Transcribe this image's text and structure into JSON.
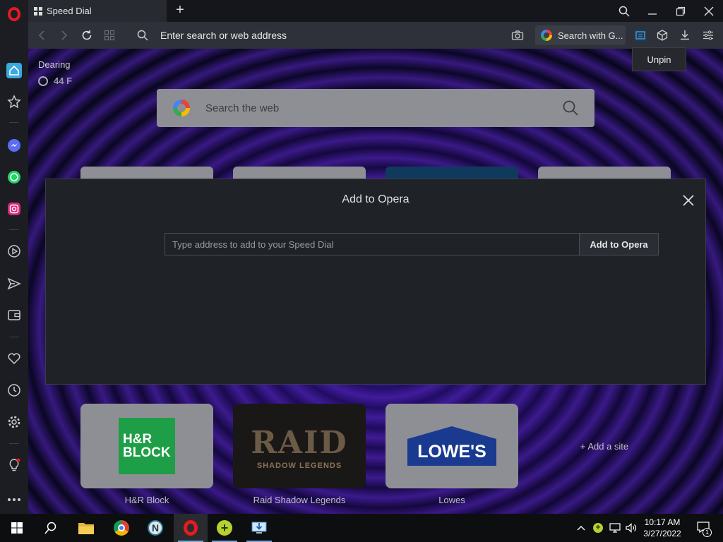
{
  "tab": {
    "title": "Speed Dial"
  },
  "address_bar": {
    "placeholder": "Enter search or web address",
    "search_engine_label": "Search with G..."
  },
  "tooltip": {
    "text": "Unpin"
  },
  "weather": {
    "location": "Dearing",
    "temperature": "44 F"
  },
  "search_box": {
    "placeholder": "Search the web"
  },
  "modal": {
    "title": "Add to Opera",
    "input_placeholder": "Type address to add to your Speed Dial",
    "button_label": "Add to Opera"
  },
  "speed_dial": {
    "tiles": [
      {
        "label": "H&R Block",
        "logo_text_1": "H&R",
        "logo_text_2": "BLOCK",
        "brand_color": "#1e9e47"
      },
      {
        "label": "Raid Shadow Legends",
        "logo_text_1": "RAID",
        "logo_text_2": "SHADOW LEGENDS"
      },
      {
        "label": "Lowes",
        "logo_text_1": "LOWE'S",
        "brand_color": "#1a3a8f"
      }
    ],
    "add_site_label": "+ Add a site"
  },
  "sidebar": {
    "items": [
      "home-icon",
      "bookmarks-icon",
      "messenger-icon",
      "whatsapp-icon",
      "instagram-icon",
      "player-icon",
      "send-icon",
      "wallet-icon",
      "heart-icon",
      "history-icon",
      "settings-icon",
      "tips-icon",
      "more-icon"
    ]
  },
  "taskbar": {
    "time": "10:17 AM",
    "date": "3/27/2022",
    "notification_count": "1"
  },
  "colors": {
    "opera_red": "#e31b23",
    "sidebar_bg": "#1b1d23",
    "address_bar_bg": "#2e3139",
    "modal_bg": "#1f2227"
  }
}
